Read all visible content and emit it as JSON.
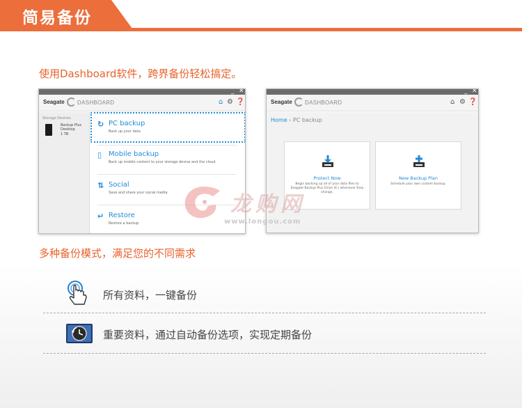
{
  "banner": {
    "title": "简易备份"
  },
  "intro": "使用Dashboard软件，跨界备份轻松搞定。",
  "window_controls": {
    "minimize": "_",
    "close": "✕"
  },
  "left_window": {
    "brand": "Seagate",
    "product": "DASHBOARD",
    "sidebar": {
      "label": "Storage Devices",
      "device_name": "Backup Plus Desktop",
      "device_size": "1 TB"
    },
    "menu": [
      {
        "title": "PC backup",
        "subtitle": "Back up your data",
        "icon": "refresh-icon"
      },
      {
        "title": "Mobile backup",
        "subtitle": "Back up mobile content to your storage device and the cloud.",
        "icon": "phone-icon"
      },
      {
        "title": "Social",
        "subtitle": "Save and share your social media",
        "icon": "sync-arrows-icon"
      },
      {
        "title": "Restore",
        "subtitle": "Restore a backup",
        "icon": "return-arrow-icon"
      }
    ]
  },
  "right_window": {
    "brand": "Seagate",
    "product": "DASHBOARD",
    "breadcrumb": {
      "home": "Home",
      "separator": "›",
      "current": "PC backup"
    },
    "cards": [
      {
        "title": "Protect Now",
        "description": "Begin backing up all of your data files to Seagate Backup Plus Drive (E:) whenever they change."
      },
      {
        "title": "New Backup Plan",
        "description": "Schedule your own custom backup."
      }
    ]
  },
  "watermark": {
    "text": "龙购网",
    "url": "www.longou.com"
  },
  "subhead": "多种备份模式，满足您的不同需求",
  "features": [
    {
      "text": "所有资料，一键备份",
      "icon": "touch-hand-icon"
    },
    {
      "text": "重要资料，通过自动备份选项，实现定期备份",
      "icon": "time-machine-icon"
    }
  ],
  "colors": {
    "accent": "#ec6e3b",
    "link_blue": "#1f8bd7"
  }
}
